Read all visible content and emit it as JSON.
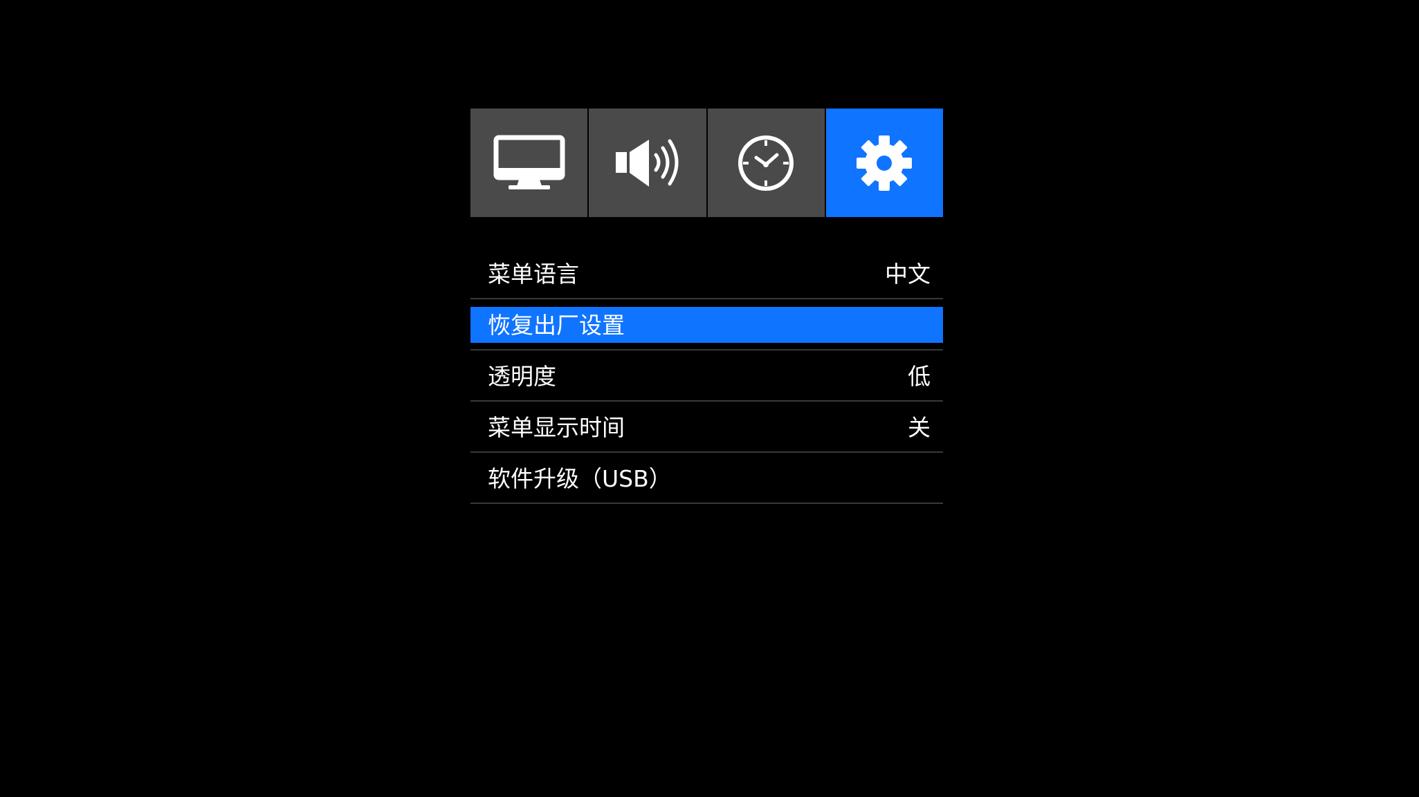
{
  "colors": {
    "background": "#000000",
    "tab_inactive": "#4a4a4a",
    "accent": "#0f74ff",
    "divider": "#3a3a3a",
    "text": "#ffffff"
  },
  "tabs": [
    {
      "id": "picture",
      "icon": "monitor-icon",
      "active": false
    },
    {
      "id": "sound",
      "icon": "speaker-icon",
      "active": false
    },
    {
      "id": "time",
      "icon": "clock-icon",
      "active": false
    },
    {
      "id": "setup",
      "icon": "gear-icon",
      "active": true
    }
  ],
  "menu": {
    "items": [
      {
        "label": "菜单语言",
        "value": "中文",
        "selected": false
      },
      {
        "label": "恢复出厂设置",
        "value": "",
        "selected": true
      },
      {
        "label": "透明度",
        "value": "低",
        "selected": false
      },
      {
        "label": "菜单显示时间",
        "value": "关",
        "selected": false
      },
      {
        "label": "软件升级（USB）",
        "value": "",
        "selected": false
      }
    ]
  }
}
